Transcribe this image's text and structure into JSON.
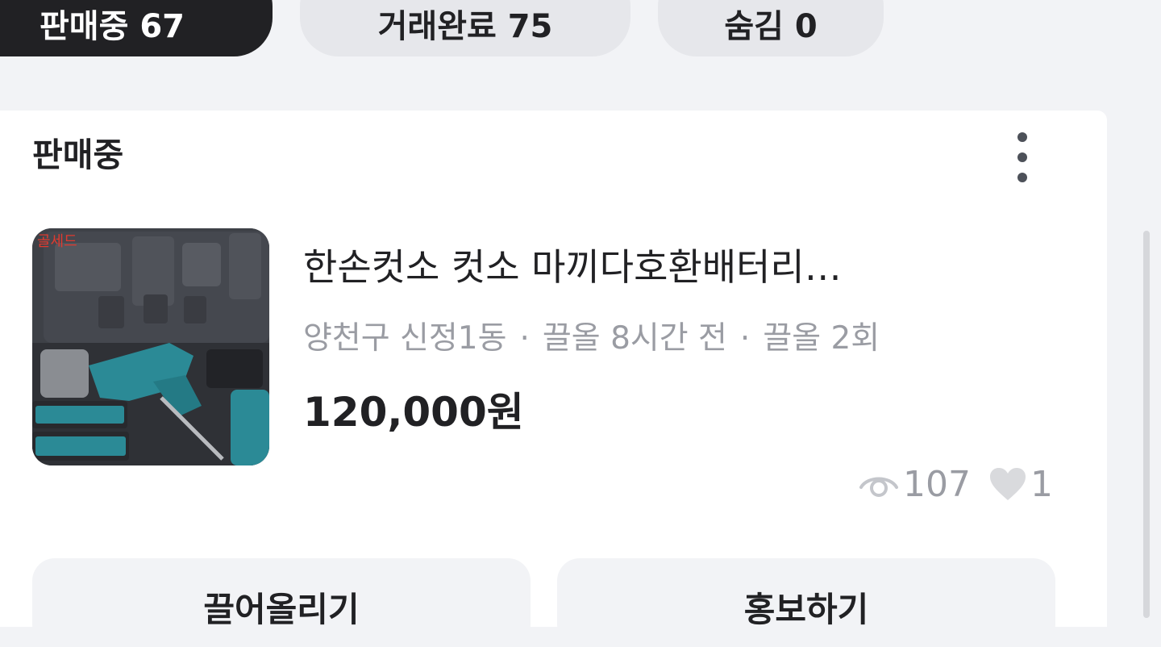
{
  "tabs": [
    {
      "label": "판매중 67",
      "active": true
    },
    {
      "label": "거래완료 75",
      "active": false
    },
    {
      "label": "숨김 0",
      "active": false
    }
  ],
  "section": {
    "status_title": "판매중",
    "more_icon": "more-vertical-icon"
  },
  "item": {
    "title": "한손컷소 컷소 마끼다호환배터리…",
    "thumbnail_text": "골세드",
    "meta": {
      "location": "양천구 신정1동",
      "bumped": "끌올 8시간 전",
      "bump_count": "끌올 2회"
    },
    "price": "120,000원",
    "views": "107",
    "likes": "1"
  },
  "actions": {
    "bump_label": "끌어올리기",
    "promote_label": "홍보하기"
  },
  "colors": {
    "active_tab": "#212124",
    "inactive_tab": "#e6e7eb",
    "background": "#f2f3f6",
    "muted_text": "#9a9ca3"
  }
}
